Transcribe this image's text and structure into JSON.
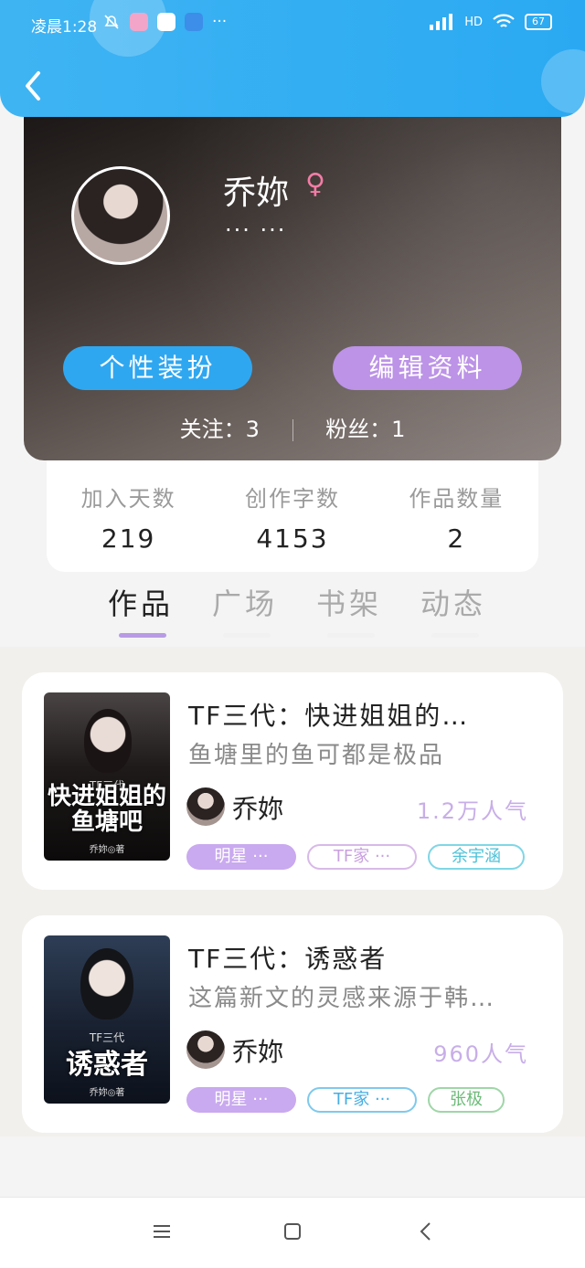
{
  "status_bar": {
    "time": "凌晨1:28",
    "more": "···",
    "network": "HD",
    "battery": "67"
  },
  "profile": {
    "name": "乔妳",
    "gender_symbol": "♀",
    "signature": "··· ···",
    "outfit_button": "个性装扮",
    "edit_button": "编辑资料",
    "following_label": "关注：",
    "following_count": "3",
    "followers_label": "粉丝：",
    "followers_count": "1"
  },
  "stats": [
    {
      "label": "加入天数",
      "value": "219"
    },
    {
      "label": "创作字数",
      "value": "4153"
    },
    {
      "label": "作品数量",
      "value": "2"
    }
  ],
  "tabs": [
    {
      "label": "作品",
      "active": true
    },
    {
      "label": "广场",
      "active": false
    },
    {
      "label": "书架",
      "active": false
    },
    {
      "label": "动态",
      "active": false
    }
  ],
  "works": [
    {
      "title": "TF三代：快进姐姐的…",
      "description": "鱼塘里的鱼可都是极品",
      "author": "乔妳",
      "popularity": "1.2万人气",
      "cover_text_small": "TF三代",
      "cover_text_main": "快进姐姐的鱼塘吧",
      "cover_byline": "乔妳◎著",
      "tags": [
        "明星 ···",
        "TF家 ···",
        "余宇涵"
      ]
    },
    {
      "title": "TF三代：诱惑者",
      "description": "这篇新文的灵感来源于韩…",
      "author": "乔妳",
      "popularity": "960人气",
      "cover_text_small": "TF三代",
      "cover_text_main": "诱惑者",
      "cover_byline": "乔妳◎著",
      "tags": [
        "明星 ···",
        "TF家 ···",
        "张极"
      ]
    }
  ],
  "colors": {
    "header": "#2aa9f2",
    "outfit_button": "#2fa7f0",
    "edit_button": "#bc93e7",
    "tab_indicator": "#b89be4",
    "popularity": "#c8aee8"
  },
  "icons": {
    "back": "chevron-left-icon",
    "nav_menu": "menu-icon",
    "nav_home": "square-icon",
    "nav_back": "triangle-back-icon"
  }
}
